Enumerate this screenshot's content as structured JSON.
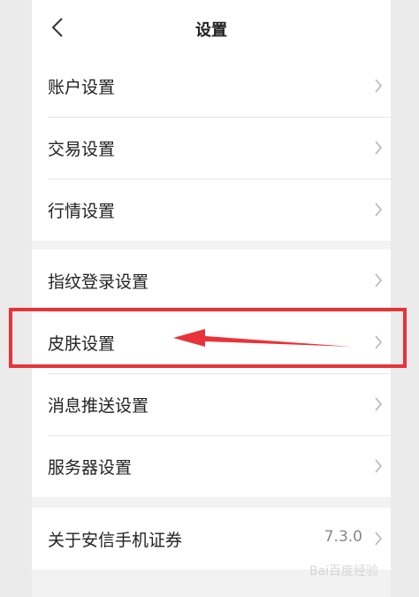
{
  "header": {
    "title": "设置",
    "back_icon": "chevron-left-icon"
  },
  "groups": [
    {
      "items": [
        {
          "label": "账户设置"
        },
        {
          "label": "交易设置"
        },
        {
          "label": "行情设置"
        }
      ]
    },
    {
      "items": [
        {
          "label": "指纹登录设置"
        },
        {
          "label": "皮肤设置",
          "highlighted": true
        },
        {
          "label": "消息推送设置"
        },
        {
          "label": "服务器设置"
        }
      ]
    },
    {
      "items": [
        {
          "label": "关于安信手机证券",
          "value": "7.3.0"
        }
      ]
    }
  ],
  "annotation": {
    "highlight_color": "#e8333a",
    "arrow_icon": "red-arrow-left"
  },
  "watermark": {
    "text": "Bai百度经验"
  }
}
